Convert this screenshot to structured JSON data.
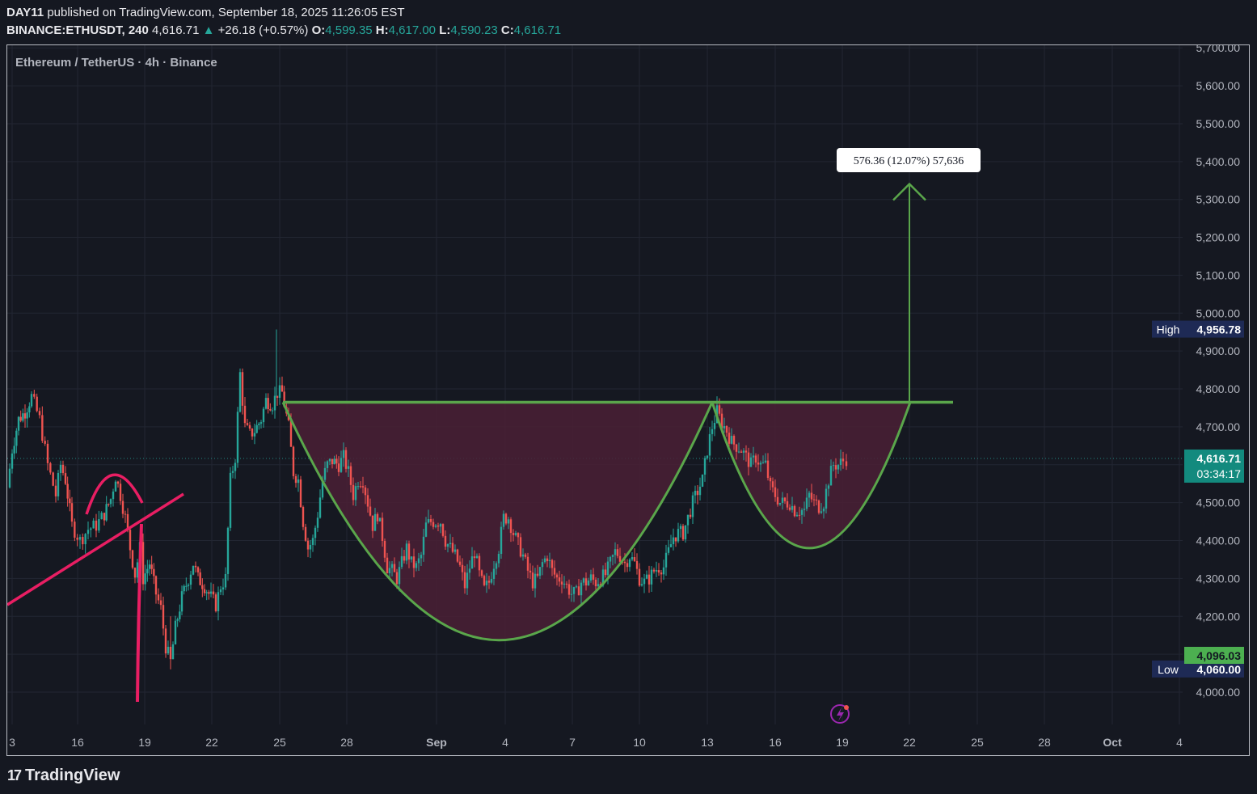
{
  "header": {
    "publisher": "DAY11",
    "published_text": " published on TradingView.com, September 18, 2025 11:26:05 EST",
    "symbol": "BINANCE:ETHUSDT, 240",
    "last": "4,616.71",
    "change": "+26.18 (+0.57%)",
    "open_label": "O:",
    "open": "4,599.35",
    "high_label": "H:",
    "high": "4,617.00",
    "low_label": "L:",
    "low": "4,590.23",
    "close_label": "C:",
    "close": "4,616.71"
  },
  "legend_title": "Ethereum / TetherUS · 4h · Binance",
  "measure_label": "576.36 (12.07%) 57,636",
  "price_tags": {
    "high_label": "High",
    "high_value": "4,956.78",
    "low_label": "Low",
    "low_value": "4,060.00",
    "current_value": "4,616.71",
    "countdown": "03:34:17",
    "green_value": "4,096.03"
  },
  "footer": {
    "brand": "TradingView",
    "logo_mark": "17"
  },
  "colors": {
    "up": "#26a69a",
    "down": "#ef5350",
    "pattern": "#5aa64b",
    "fill": "#4a2035",
    "trendline": "#e91e63"
  },
  "chart_data": {
    "type": "candlestick",
    "symbol": "ETHUSDT",
    "timeframe": "4h",
    "ylim": [
      3950,
      5700
    ],
    "y_ticks": [
      "4,000.00",
      "4,100.00",
      "4,200.00",
      "4,300.00",
      "4,400.00",
      "4,500.00",
      "4,600.00",
      "4,700.00",
      "4,800.00",
      "4,900.00",
      "5,000.00",
      "5,100.00",
      "5,200.00",
      "5,300.00",
      "5,400.00",
      "5,500.00",
      "5,600.00",
      "5,700.00"
    ],
    "x_ticks": [
      "3",
      "16",
      "19",
      "22",
      "25",
      "28",
      "Sep",
      "4",
      "7",
      "10",
      "13",
      "16",
      "19",
      "22",
      "25",
      "28",
      "Oct",
      "4"
    ],
    "current_price": 4616.71,
    "high": 4956.78,
    "low": 4060.0,
    "annotations": {
      "pattern": "cup and handle",
      "neckline": 4765,
      "cup_bottom": 4150,
      "handle_bottom": 4380,
      "target": 5341,
      "target_move": "576.36 (12.07%)"
    },
    "candle_anchors": [
      [
        0,
        4540
      ],
      [
        6,
        4640
      ],
      [
        14,
        4720
      ],
      [
        22,
        4740
      ],
      [
        30,
        4780
      ],
      [
        40,
        4720
      ],
      [
        50,
        4600
      ],
      [
        60,
        4520
      ],
      [
        66,
        4600
      ],
      [
        72,
        4560
      ],
      [
        80,
        4440
      ],
      [
        90,
        4400
      ],
      [
        100,
        4430
      ],
      [
        110,
        4440
      ],
      [
        120,
        4470
      ],
      [
        128,
        4510
      ],
      [
        134,
        4570
      ],
      [
        140,
        4520
      ],
      [
        146,
        4460
      ],
      [
        152,
        4380
      ],
      [
        158,
        4310
      ],
      [
        164,
        4380
      ],
      [
        168,
        4300
      ],
      [
        176,
        4340
      ],
      [
        184,
        4260
      ],
      [
        190,
        4220
      ],
      [
        196,
        4120
      ],
      [
        202,
        4080
      ],
      [
        208,
        4170
      ],
      [
        216,
        4250
      ],
      [
        224,
        4300
      ],
      [
        230,
        4340
      ],
      [
        236,
        4300
      ],
      [
        244,
        4280
      ],
      [
        252,
        4250
      ],
      [
        258,
        4230
      ],
      [
        264,
        4280
      ],
      [
        270,
        4300
      ],
      [
        276,
        4560
      ],
      [
        282,
        4620
      ],
      [
        288,
        4840
      ],
      [
        294,
        4700
      ],
      [
        300,
        4680
      ],
      [
        306,
        4690
      ],
      [
        314,
        4720
      ],
      [
        320,
        4770
      ],
      [
        328,
        4760
      ],
      [
        334,
        4790
      ],
      [
        340,
        4790
      ],
      [
        348,
        4700
      ],
      [
        354,
        4580
      ],
      [
        360,
        4560
      ],
      [
        366,
        4450
      ],
      [
        372,
        4380
      ],
      [
        378,
        4400
      ],
      [
        384,
        4470
      ],
      [
        390,
        4560
      ],
      [
        396,
        4600
      ],
      [
        402,
        4610
      ],
      [
        410,
        4600
      ],
      [
        416,
        4620
      ],
      [
        422,
        4580
      ],
      [
        428,
        4520
      ],
      [
        434,
        4560
      ],
      [
        440,
        4560
      ],
      [
        446,
        4500
      ],
      [
        452,
        4440
      ],
      [
        458,
        4470
      ],
      [
        464,
        4410
      ],
      [
        470,
        4330
      ],
      [
        476,
        4320
      ],
      [
        482,
        4300
      ],
      [
        488,
        4340
      ],
      [
        494,
        4380
      ],
      [
        500,
        4340
      ],
      [
        506,
        4330
      ],
      [
        512,
        4360
      ],
      [
        518,
        4440
      ],
      [
        524,
        4450
      ],
      [
        530,
        4450
      ],
      [
        536,
        4450
      ],
      [
        542,
        4400
      ],
      [
        548,
        4380
      ],
      [
        554,
        4360
      ],
      [
        560,
        4330
      ],
      [
        566,
        4280
      ],
      [
        572,
        4330
      ],
      [
        578,
        4370
      ],
      [
        584,
        4310
      ],
      [
        590,
        4270
      ],
      [
        596,
        4290
      ],
      [
        602,
        4340
      ],
      [
        608,
        4380
      ],
      [
        614,
        4460
      ],
      [
        620,
        4460
      ],
      [
        626,
        4420
      ],
      [
        632,
        4390
      ],
      [
        638,
        4360
      ],
      [
        644,
        4320
      ],
      [
        650,
        4290
      ],
      [
        656,
        4300
      ],
      [
        662,
        4340
      ],
      [
        668,
        4360
      ],
      [
        674,
        4320
      ],
      [
        680,
        4300
      ],
      [
        686,
        4300
      ],
      [
        692,
        4280
      ],
      [
        698,
        4260
      ],
      [
        704,
        4260
      ],
      [
        710,
        4290
      ],
      [
        716,
        4290
      ],
      [
        722,
        4300
      ],
      [
        728,
        4290
      ],
      [
        734,
        4300
      ],
      [
        740,
        4310
      ],
      [
        746,
        4340
      ],
      [
        752,
        4370
      ],
      [
        758,
        4360
      ],
      [
        764,
        4340
      ],
      [
        770,
        4360
      ],
      [
        776,
        4340
      ],
      [
        782,
        4300
      ],
      [
        788,
        4290
      ],
      [
        794,
        4300
      ],
      [
        800,
        4320
      ],
      [
        806,
        4330
      ],
      [
        812,
        4330
      ],
      [
        818,
        4370
      ],
      [
        824,
        4410
      ],
      [
        830,
        4420
      ],
      [
        836,
        4420
      ],
      [
        842,
        4460
      ],
      [
        848,
        4500
      ],
      [
        854,
        4530
      ],
      [
        860,
        4560
      ],
      [
        866,
        4640
      ],
      [
        872,
        4700
      ],
      [
        878,
        4740
      ],
      [
        884,
        4710
      ],
      [
        890,
        4690
      ],
      [
        896,
        4660
      ],
      [
        902,
        4650
      ],
      [
        908,
        4640
      ],
      [
        914,
        4620
      ],
      [
        920,
        4600
      ],
      [
        926,
        4620
      ],
      [
        932,
        4600
      ],
      [
        938,
        4600
      ],
      [
        944,
        4540
      ],
      [
        950,
        4520
      ],
      [
        956,
        4500
      ],
      [
        962,
        4500
      ],
      [
        968,
        4500
      ],
      [
        974,
        4480
      ],
      [
        980,
        4480
      ],
      [
        986,
        4480
      ],
      [
        992,
        4520
      ],
      [
        998,
        4500
      ],
      [
        1004,
        4490
      ],
      [
        1010,
        4500
      ],
      [
        1016,
        4560
      ],
      [
        1022,
        4600
      ],
      [
        1028,
        4600
      ],
      [
        1034,
        4610
      ],
      [
        1038,
        4616
      ]
    ]
  }
}
